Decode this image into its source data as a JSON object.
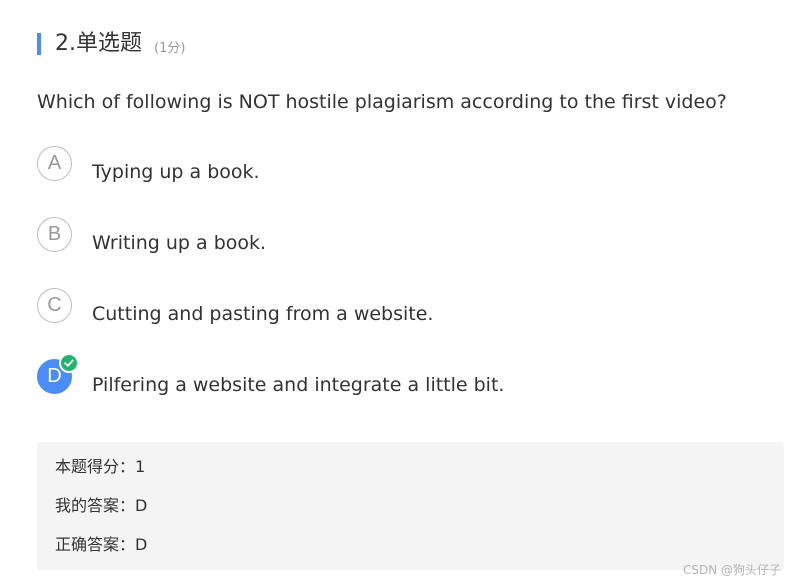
{
  "question": {
    "number_title": "2.单选题",
    "score_note": "(1分)",
    "text": "Which of following is NOT hostile plagiarism according to the first video?"
  },
  "options": [
    {
      "letter": "A",
      "label": "Typing up a book.",
      "selected": false
    },
    {
      "letter": "B",
      "label": "Writing up a book.",
      "selected": false
    },
    {
      "letter": "C",
      "label": "Cutting and pasting from a website.",
      "selected": false
    },
    {
      "letter": "D",
      "label": "Pilfering a website and integrate a little bit.",
      "selected": true,
      "icon": "check-circle-icon"
    }
  ],
  "answer_summary": {
    "score": "本题得分：1",
    "my_answer": "我的答案：D",
    "correct_answer": "正确答案：D"
  },
  "watermark": "CSDN @狗头仔子",
  "colors": {
    "accent_blue": "#4a8df6",
    "check_green": "#1fb36b",
    "panel_bg": "#f4f4f4"
  }
}
